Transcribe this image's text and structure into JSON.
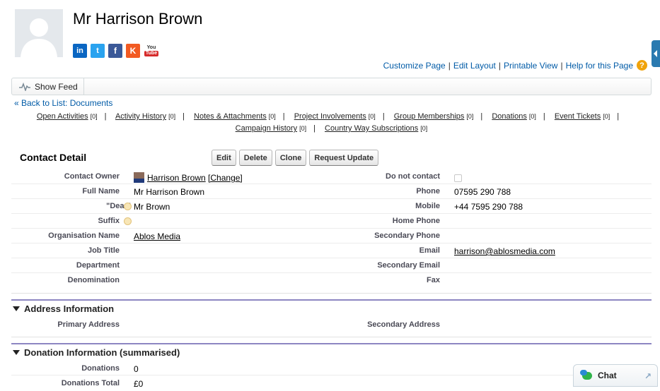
{
  "header": {
    "name": "Mr Harrison Brown",
    "social": {
      "linkedin": "in",
      "twitter": "t",
      "facebook": "f",
      "klout": "K",
      "youtube_top": "You",
      "youtube_bottom": "Tube"
    }
  },
  "page_links": {
    "customize": "Customize Page",
    "edit_layout": "Edit Layout",
    "printable": "Printable View",
    "help": "Help for this Page",
    "separator": "|",
    "help_icon": "?"
  },
  "feed": {
    "show_feed": "Show Feed"
  },
  "back": {
    "label": "« Back to List: Documents"
  },
  "related_lists": [
    {
      "label": "Open Activities",
      "count": "[0]"
    },
    {
      "label": "Activity History",
      "count": "[0]"
    },
    {
      "label": "Notes & Attachments",
      "count": "[0]"
    },
    {
      "label": "Project Involvements",
      "count": "[0]"
    },
    {
      "label": "Group Memberships",
      "count": "[0]"
    },
    {
      "label": "Donations",
      "count": "[0]"
    },
    {
      "label": "Event Tickets",
      "count": "[0]"
    },
    {
      "label": "Campaign History",
      "count": "[0]"
    },
    {
      "label": "Country Way Subscriptions",
      "count": "[0]"
    }
  ],
  "contact_detail": {
    "title": "Contact Detail",
    "buttons": {
      "edit": "Edit",
      "delete": "Delete",
      "clone": "Clone",
      "request_update": "Request Update"
    },
    "left": {
      "contact_owner_label": "Contact Owner",
      "contact_owner_value": "Harrison Brown",
      "change_link": "[Change]",
      "full_name_label": "Full Name",
      "full_name_value": "Mr Harrison Brown",
      "dear_label": "\"Dear\"",
      "dear_value": "Mr Brown",
      "suffix_label": "Suffix",
      "org_label": "Organisation Name",
      "org_value": "Ablos Media",
      "job_title_label": "Job Title",
      "department_label": "Department",
      "denomination_label": "Denomination"
    },
    "right": {
      "do_not_contact_label": "Do not contact",
      "phone_label": "Phone",
      "phone_value": "07595 290 788",
      "mobile_label": "Mobile",
      "mobile_value": "+44 7595 290 788",
      "home_phone_label": "Home Phone",
      "secondary_phone_label": "Secondary Phone",
      "email_label": "Email",
      "email_value": "harrison@ablosmedia.com",
      "secondary_email_label": "Secondary Email",
      "fax_label": "Fax"
    }
  },
  "address": {
    "title": "Address Information",
    "primary_label": "Primary Address",
    "secondary_label": "Secondary Address"
  },
  "donation": {
    "title": "Donation Information (summarised)",
    "donations_label": "Donations",
    "donations_value": "0",
    "donations_total_label": "Donations Total",
    "donations_total_value": "£0"
  },
  "chat": {
    "label": "Chat",
    "expand_icon": "↗"
  }
}
